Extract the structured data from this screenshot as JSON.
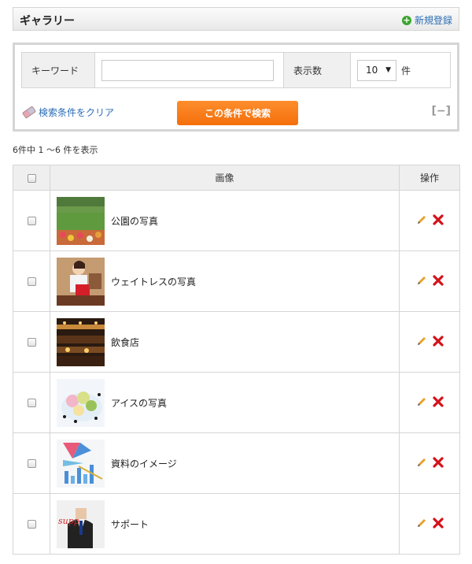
{
  "header": {
    "title": "ギャラリー",
    "new_label": "新規登録"
  },
  "search": {
    "keyword_label": "キーワード",
    "keyword_value": "",
    "count_label": "表示数",
    "count_value": "10",
    "count_unit": "件",
    "clear_label": "検索条件をクリア",
    "submit_label": "この条件で検索",
    "collapse_label": "[−]"
  },
  "summary": "6件中 1 〜6 件を表示",
  "table": {
    "col_image": "画像",
    "col_ops": "操作",
    "rows": [
      {
        "label": "公園の写真",
        "thumb": "park-photo"
      },
      {
        "label": "ウェイトレスの写真",
        "thumb": "waitress-photo"
      },
      {
        "label": "飲食店",
        "thumb": "restaurant-photo"
      },
      {
        "label": "アイスの写真",
        "thumb": "ice-cream-photo"
      },
      {
        "label": "資料のイメージ",
        "thumb": "document-chart-photo"
      },
      {
        "label": "サポート",
        "thumb": "support-photo"
      }
    ]
  },
  "colors": {
    "accent_orange": "#f47b12",
    "link_blue": "#2a6db5",
    "delete_red": "#d4121a",
    "add_green": "#3aa52e"
  }
}
